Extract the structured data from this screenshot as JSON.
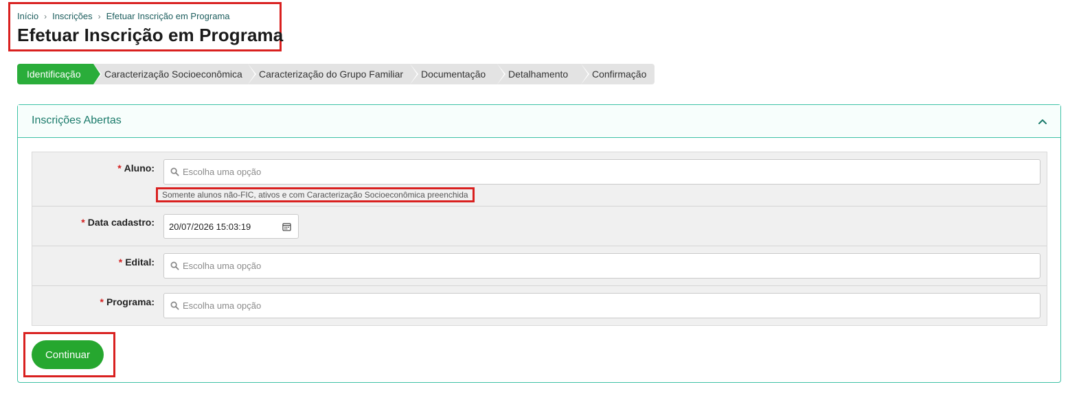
{
  "breadcrumb": {
    "items": [
      "Início",
      "Inscrições",
      "Efetuar Inscrição em Programa"
    ],
    "separator": "›"
  },
  "page_title": "Efetuar Inscrição em Programa",
  "steps": [
    {
      "label": "Identificação",
      "active": true
    },
    {
      "label": "Caracterização Socioeconômica",
      "active": false
    },
    {
      "label": "Caracterização do Grupo Familiar",
      "active": false
    },
    {
      "label": "Documentação",
      "active": false
    },
    {
      "label": "Detalhamento",
      "active": false
    },
    {
      "label": "Confirmação",
      "active": false
    }
  ],
  "card": {
    "title": "Inscrições Abertas",
    "collapse_icon": "chevron-up-icon"
  },
  "form": {
    "required_marker": "*",
    "aluno": {
      "label": "Aluno:",
      "placeholder": "Escolha uma opção",
      "help": "Somente alunos não-FIC, ativos e com Caracterização Socioeconômica preenchida"
    },
    "data_cadastro": {
      "label": "Data cadastro:",
      "value": "20/07/2026 15:03:19"
    },
    "edital": {
      "label": "Edital:",
      "placeholder": "Escolha uma opção"
    },
    "programa": {
      "label": "Programa:",
      "placeholder": "Escolha uma opção"
    }
  },
  "continue_label": "Continuar",
  "colors": {
    "accent_green": "#2aad3a",
    "teal_border": "#3cc1a5",
    "annotation_red": "#d9201f",
    "required_red": "#d42020"
  }
}
